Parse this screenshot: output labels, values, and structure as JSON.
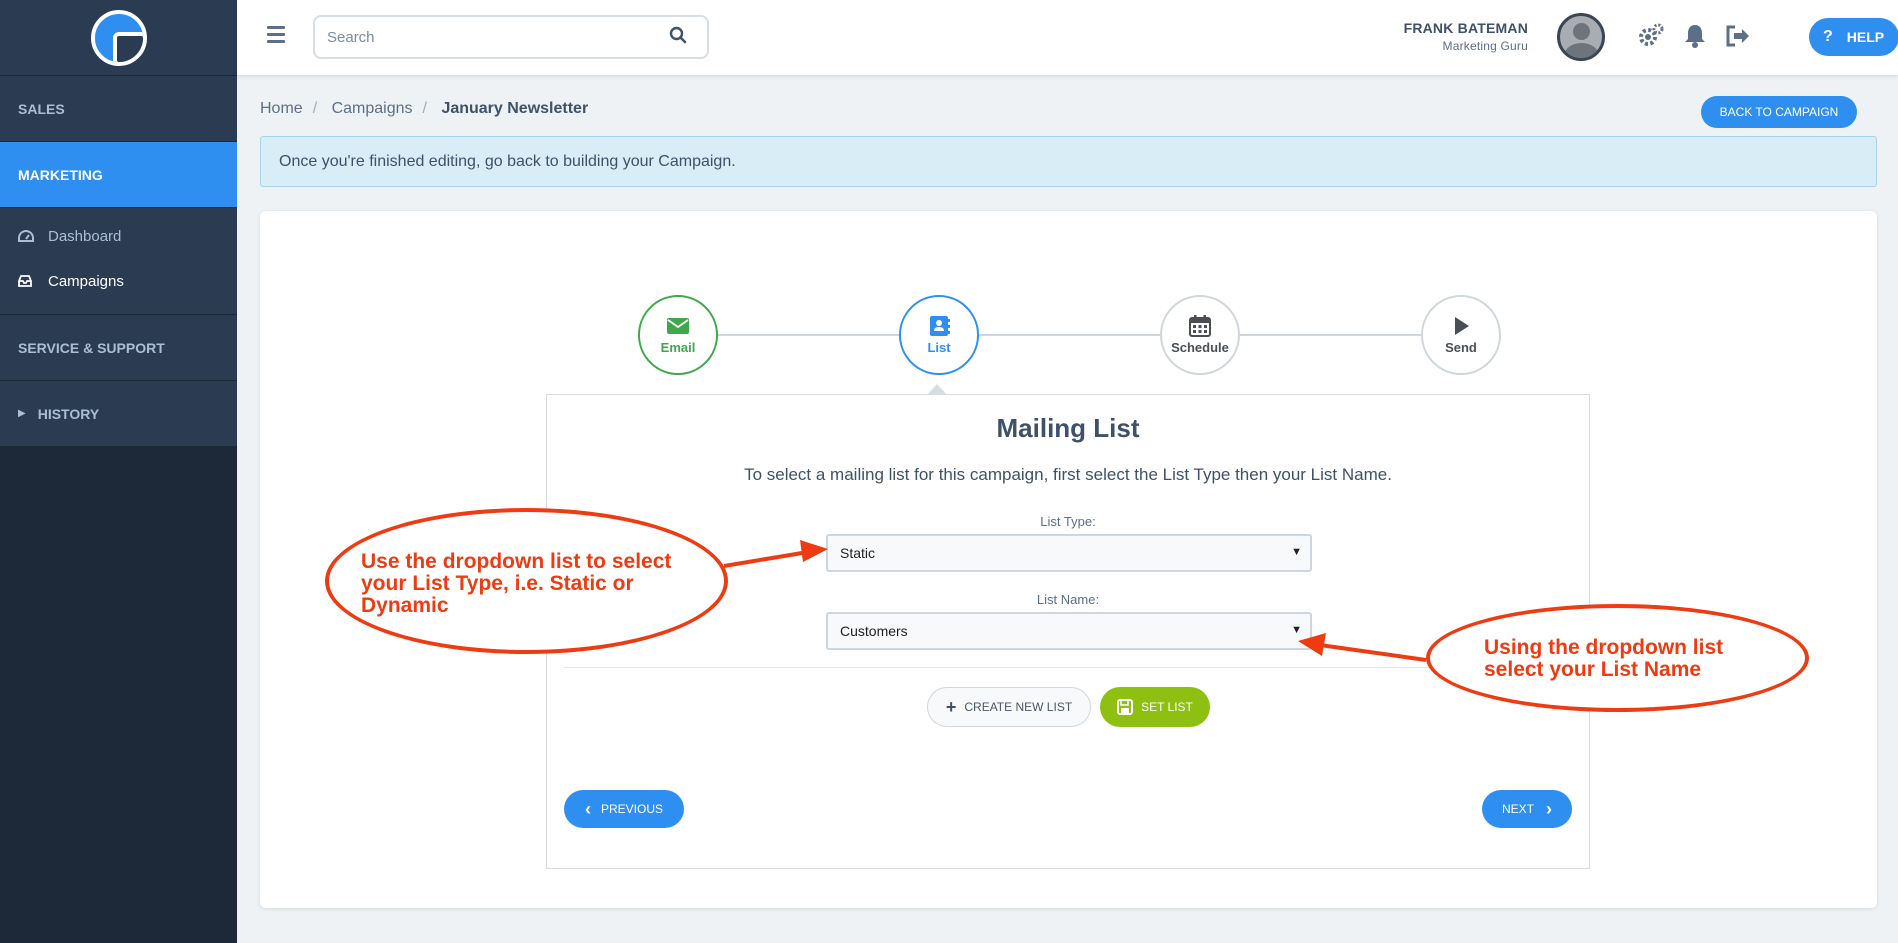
{
  "sidebar": {
    "sections": [
      "SALES",
      "MARKETING"
    ],
    "items": [
      {
        "label": "Dashboard"
      },
      {
        "label": "Campaigns"
      }
    ],
    "service": "SERVICE & SUPPORT",
    "history": "HISTORY"
  },
  "topbar": {
    "search_placeholder": "Search",
    "user_name": "FRANK BATEMAN",
    "user_role": "Marketing Guru",
    "help_label": "HELP"
  },
  "breadcrumb": [
    "Home",
    "Campaigns",
    "January Newsletter"
  ],
  "back_button": "BACK TO CAMPAIGN",
  "alert": "Once you're finished editing, go back to building your Campaign.",
  "steps": [
    {
      "label": "Email",
      "icon": "envelope-icon",
      "status": "done"
    },
    {
      "label": "List",
      "icon": "address-book-icon",
      "status": "active"
    },
    {
      "label": "Schedule",
      "icon": "calendar-icon",
      "status": "pending"
    },
    {
      "label": "Send",
      "icon": "play-icon",
      "status": "pending"
    }
  ],
  "panel": {
    "title": "Mailing List",
    "description": "To select a mailing list for this campaign, first select the List Type then your List Name.",
    "list_type_label": "List Type:",
    "list_type_value": "Static",
    "list_name_label": "List Name:",
    "list_name_value": "Customers",
    "create_button": "CREATE NEW LIST",
    "set_button": "SET LIST",
    "previous_button": "PREVIOUS",
    "next_button": "NEXT"
  },
  "annotations": {
    "left_text": "Use the dropdown list to select your List Type, i.e. Static or Dynamic",
    "right_text": "Using the dropdown list select your List Name",
    "color": "#ee3b11"
  },
  "colors": {
    "accent": "#2e8ff0",
    "success": "#3fa84b",
    "set_button": "#8dc010",
    "sidebar": "#1d2939"
  }
}
